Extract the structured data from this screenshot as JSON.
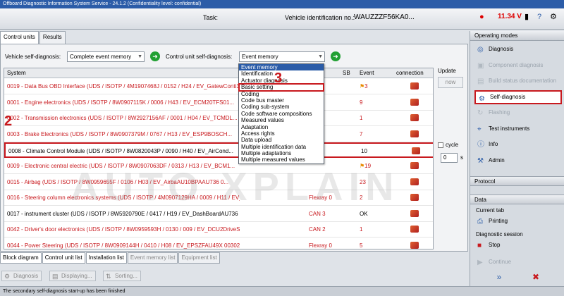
{
  "window": {
    "title": "Offboard Diagnostic Information System Service - 24.1.2 (Confidentiality level: confidential)"
  },
  "header": {
    "task_label": "Task:",
    "vin_label": "Vehicle identification no.:",
    "vin_value": "WAUZZZF56KA0...",
    "battery": "11.34 V",
    "icons": [
      "car-icon",
      "battery-icon",
      "dongle-icon",
      "vas-icon",
      "help-icon",
      "wrench-icon"
    ]
  },
  "tabs_top": [
    "Control units",
    "Results"
  ],
  "selectors": {
    "vehicle_label": "Vehicle self-diagnosis:",
    "vehicle_value": "Complete event memory",
    "cu_label": "Control unit self-diagnosis:",
    "cu_value": "Event memory"
  },
  "table": {
    "headers": {
      "system": "System",
      "sb": "SB",
      "event": "Event",
      "connection": "connection"
    },
    "rows": [
      {
        "name": "0019 - Data Bus OBD Interface  (UDS / ISOTP / 4M1907468J / 0152 / H24 / EV_GatewConti3 ...",
        "bus": "",
        "event": "3",
        "flag": true,
        "red": true
      },
      {
        "name": "0001 - Engine electronics  (UDS / ISOTP / 8W0907115K / 0006 / H43 / EV_ECM20TFS01...",
        "bus": "",
        "event": "9",
        "flag": false,
        "red": true
      },
      {
        "name": "0002 - Transmission electronics  (UDS / ISOTP / 8W2927156AF / 0001 / H04 / EV_TCMDL...",
        "bus": "",
        "event": "1",
        "flag": false,
        "red": true
      },
      {
        "name": "0003 - Brake Electronics  (UDS / ISOTP / 8W0907379M / 0767 / H13 / EV_ESP9BOSCH...",
        "bus": "",
        "event": "7",
        "flag": false,
        "red": true
      },
      {
        "name": "0008 - Climate Control Module  (UDS / ISOTP / 8W0820043P / 0090 / H40 / EV_AirCond...",
        "bus": "",
        "event": "10",
        "flag": false,
        "red": false
      },
      {
        "name": "0009 - Electronic central electric  (UDS / ISOTP / 8W0907063DF / 0313 / H13 / EV_BCM1...",
        "bus": "",
        "event": "19",
        "flag": true,
        "red": true
      },
      {
        "name": "0015 - Airbag  (UDS / ISOTP / 8W0959655F / 0106 / H03 / EV_AirbaAU10BPAAU736 0...",
        "bus": "",
        "event": "23",
        "flag": false,
        "red": true
      },
      {
        "name": "0016 - Steering column electronics systems  (UDS / ISOTP / 4M0907129HA / 0009 / H11 / EV_SMLSKL...",
        "bus": "Flexray 0",
        "event": "2",
        "flag": false,
        "red": true
      },
      {
        "name": "0017 - instrument cluster  (UDS / ISOTP / 8W5920790E / 0417 / H19 / EV_DashBoardAU736 001032)",
        "bus": "CAN 3",
        "event": "OK",
        "flag": false,
        "red": false
      },
      {
        "name": "0042 - Driver's door electronics  (UDS / ISOTP / 8W0959593H / 0130 / 009 / EV_DCU2DriveSideMAXH(...",
        "bus": "CAN 2",
        "event": "1",
        "flag": false,
        "red": true
      },
      {
        "name": "0044 - Power Steering  (UDS / ISOTP / 8W0909144H / 0410 / H08 / EV_EPSZFAU49X 003023)",
        "bus": "Flexray 0",
        "event": "5",
        "flag": false,
        "red": true
      }
    ]
  },
  "dropdown": {
    "items": [
      "Event memory",
      "Identification",
      "Actuator diagnosis",
      "Basic setting",
      "Coding",
      "Code bus master",
      "Coding sub-system",
      "Code software compositions",
      "Measured values",
      "Adaptation",
      "Access rights",
      "Data upload",
      "Multiple identification data",
      "Multiple adaptations",
      "Multiple measured values"
    ]
  },
  "update": {
    "label": "Update",
    "now": "now",
    "cycle": "cycle",
    "seconds": "0",
    "unit": "s"
  },
  "callouts": {
    "one": "1",
    "two": "2",
    "three": "3"
  },
  "right_panel": {
    "operating_modes": "Operating modes",
    "items": [
      {
        "label": "Diagnosis",
        "icon": "diagnosis-icon",
        "state": "normal"
      },
      {
        "label": "Component diagnosis",
        "icon": "component-icon",
        "state": "disabled"
      },
      {
        "label": "Build status documentation",
        "icon": "build-icon",
        "state": "disabled"
      },
      {
        "label": "Self-diagnosis",
        "icon": "self-diagnosis-icon",
        "state": "active"
      },
      {
        "label": "Flashing",
        "icon": "flashing-icon",
        "state": "disabled"
      },
      {
        "label": "Test instruments",
        "icon": "test-instruments-icon",
        "state": "normal"
      },
      {
        "label": "Info",
        "icon": "info-icon",
        "state": "normal"
      },
      {
        "label": "Admin",
        "icon": "admin-icon",
        "state": "normal"
      }
    ],
    "protocol": "Protocol",
    "data": "Data",
    "current_tab": "Current tab",
    "printing": "Printing",
    "diag_session": "Diagnostic session",
    "stop": "Stop",
    "continue": "Continue"
  },
  "bottom_tabs": [
    "Block diagram",
    "Control unit list",
    "Installation list",
    "Event memory list",
    "Equipment list"
  ],
  "buttons": [
    "Diagnosis",
    "Displaying...",
    "Sorting..."
  ],
  "status": "The secondary self-diagnosis start-up has been finished",
  "watermark": "AUTO  XPLAIN",
  "colors": {
    "accent": "#2b5ca8",
    "alert": "#c8191e",
    "ok": "#22a033"
  }
}
